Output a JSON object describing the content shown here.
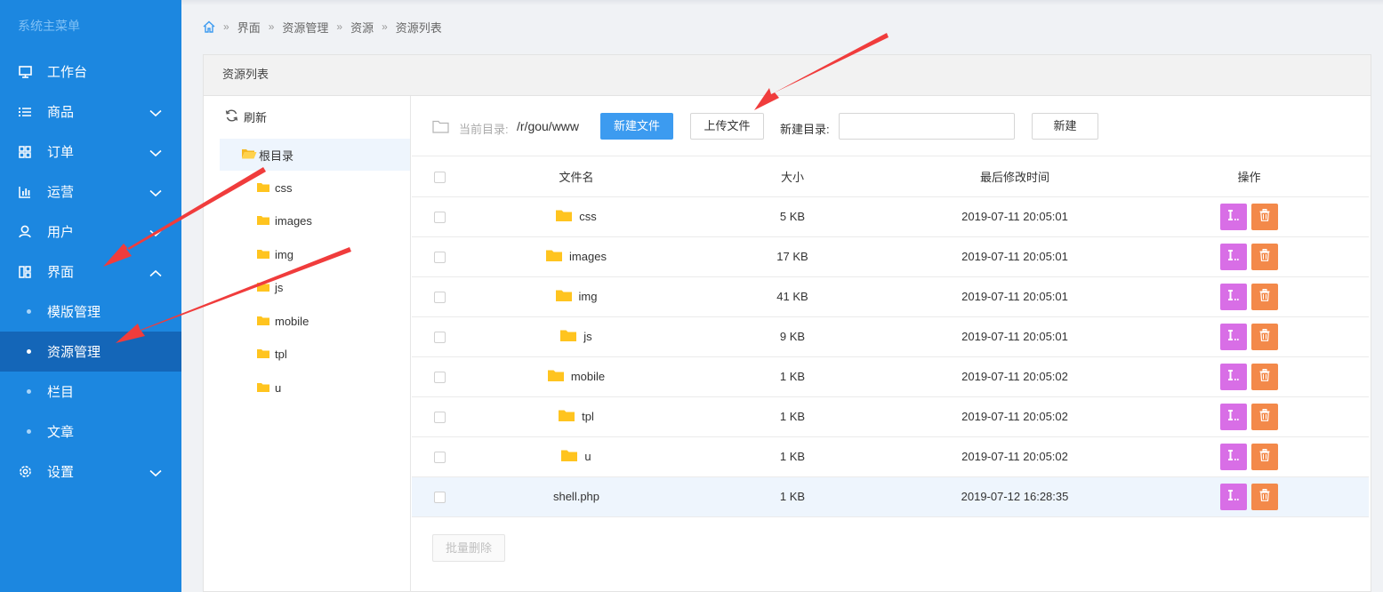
{
  "sidebar": {
    "title": "系统主菜单",
    "menu": [
      {
        "label": "工作台",
        "icon": "monitor-icon",
        "has_chevron": false
      },
      {
        "label": "商品",
        "icon": "list-icon",
        "has_chevron": true
      },
      {
        "label": "订单",
        "icon": "grid-icon",
        "has_chevron": true
      },
      {
        "label": "运营",
        "icon": "bar-chart-icon",
        "has_chevron": true
      },
      {
        "label": "用户",
        "icon": "user-icon",
        "has_chevron": true
      },
      {
        "label": "界面",
        "icon": "layout-icon",
        "has_chevron": true,
        "expanded": true
      }
    ],
    "submenu": [
      {
        "label": "模版管理",
        "active": false
      },
      {
        "label": "资源管理",
        "active": true
      },
      {
        "label": "栏目",
        "active": false
      },
      {
        "label": "文章",
        "active": false
      }
    ],
    "settings": {
      "label": "设置",
      "icon": "gear-icon"
    }
  },
  "breadcrumb": [
    "界面",
    "资源管理",
    "资源",
    "资源列表"
  ],
  "panel": {
    "title": "资源列表"
  },
  "tree": {
    "refresh_label": "刷新",
    "root_label": "根目录",
    "nodes": [
      "css",
      "images",
      "img",
      "js",
      "mobile",
      "tpl",
      "u"
    ]
  },
  "toolbar": {
    "current_dir_label": "当前目录:",
    "current_dir_value": "/r/gou/www",
    "new_file_label": "新建文件",
    "upload_label": "上传文件",
    "new_dir_label": "新建目录:",
    "new_dir_value": "",
    "create_label": "新建"
  },
  "table": {
    "headers": {
      "name": "文件名",
      "size": "大小",
      "mtime": "最后修改时间",
      "ops": "操作"
    },
    "rows": [
      {
        "name": "css",
        "is_dir": true,
        "size": "5 KB",
        "mtime": "2019-07-11 20:05:01"
      },
      {
        "name": "images",
        "is_dir": true,
        "size": "17 KB",
        "mtime": "2019-07-11 20:05:01"
      },
      {
        "name": "img",
        "is_dir": true,
        "size": "41 KB",
        "mtime": "2019-07-11 20:05:01"
      },
      {
        "name": "js",
        "is_dir": true,
        "size": "9 KB",
        "mtime": "2019-07-11 20:05:01"
      },
      {
        "name": "mobile",
        "is_dir": true,
        "size": "1 KB",
        "mtime": "2019-07-11 20:05:02"
      },
      {
        "name": "tpl",
        "is_dir": true,
        "size": "1 KB",
        "mtime": "2019-07-11 20:05:02"
      },
      {
        "name": "u",
        "is_dir": true,
        "size": "1 KB",
        "mtime": "2019-07-11 20:05:02"
      },
      {
        "name": "shell.php",
        "is_dir": false,
        "size": "1 KB",
        "mtime": "2019-07-12 16:28:35",
        "highlighted": true
      }
    ],
    "batch_delete_label": "批量删除"
  },
  "colors": {
    "sidebar_bg": "#1c87e0",
    "sidebar_active": "#1466b8",
    "primary": "#3c9bf0",
    "edit_btn": "#d86ee6",
    "delete_btn": "#f3894a",
    "folder": "#ffc41f",
    "annotation_arrow": "#f03c3c"
  }
}
